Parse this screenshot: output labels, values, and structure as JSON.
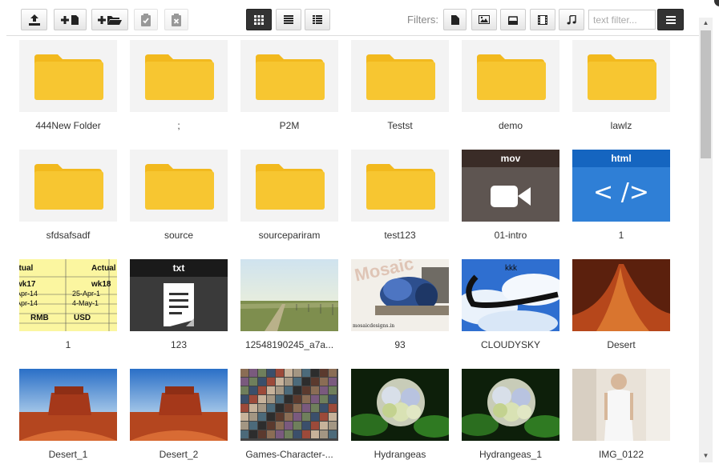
{
  "toolbar": {
    "upload_label": "upload",
    "new_file_label": "new file",
    "new_folder_label": "new folder",
    "select_all_label": "select all",
    "clear_selection_label": "clear selection",
    "filters_label": "Filters:",
    "text_filter_placeholder": "text filter...",
    "view_modes": [
      "grid",
      "list",
      "columns"
    ],
    "active_view": "grid",
    "filter_types": [
      "file-icon",
      "image-icon",
      "archive-icon",
      "video-icon",
      "music-icon"
    ]
  },
  "files": [
    {
      "name": "444New Folder",
      "type": "folder"
    },
    {
      "name": ";",
      "type": "folder"
    },
    {
      "name": "P2M",
      "type": "folder"
    },
    {
      "name": "Testst",
      "type": "folder"
    },
    {
      "name": "demo",
      "type": "folder"
    },
    {
      "name": "lawlz",
      "type": "folder"
    },
    {
      "name": "sfdsafsadf",
      "type": "folder"
    },
    {
      "name": "source",
      "type": "folder"
    },
    {
      "name": "sourcepariram",
      "type": "folder"
    },
    {
      "name": "test123",
      "type": "folder"
    },
    {
      "name": "01-intro",
      "type": "mov",
      "badge": "mov"
    },
    {
      "name": "1",
      "type": "html",
      "badge": "html",
      "glyph": "< />"
    },
    {
      "name": "1",
      "type": "spreadsheet-image",
      "cells": [
        "ctual",
        "Actual",
        "wk17",
        "wk18",
        "Apr-14",
        "25-Apr-1",
        "Apr-14",
        "4-May-1",
        "RMB",
        "USD"
      ]
    },
    {
      "name": "123",
      "type": "txt",
      "badge": "txt"
    },
    {
      "name": "12548190245_a7a...",
      "type": "landscape-image"
    },
    {
      "name": "93",
      "type": "mosaic-image",
      "watermark": "Mosaic",
      "caption": "mosaicdesigns.in"
    },
    {
      "name": "CLOUDYSKY",
      "type": "sky-image",
      "caption": "kkk"
    },
    {
      "name": "Desert",
      "type": "sand-image"
    },
    {
      "name": "Desert_1",
      "type": "desert-image"
    },
    {
      "name": "Desert_2",
      "type": "desert-image"
    },
    {
      "name": "Games-Character-...",
      "type": "collage-image"
    },
    {
      "name": "Hydrangeas",
      "type": "flower-image"
    },
    {
      "name": "Hydrangeas_1",
      "type": "flower-image"
    },
    {
      "name": "IMG_0122",
      "type": "person-image"
    }
  ],
  "colors": {
    "folder": "#f7c631",
    "folder_tab": "#f2b91e",
    "mov_header": "#3a2c27",
    "mov_body": "#5e5551",
    "html_header": "#1565c0",
    "html_body": "#2f7fd6",
    "txt_header": "#1a1a1a",
    "txt_body": "#3a3a3a"
  }
}
